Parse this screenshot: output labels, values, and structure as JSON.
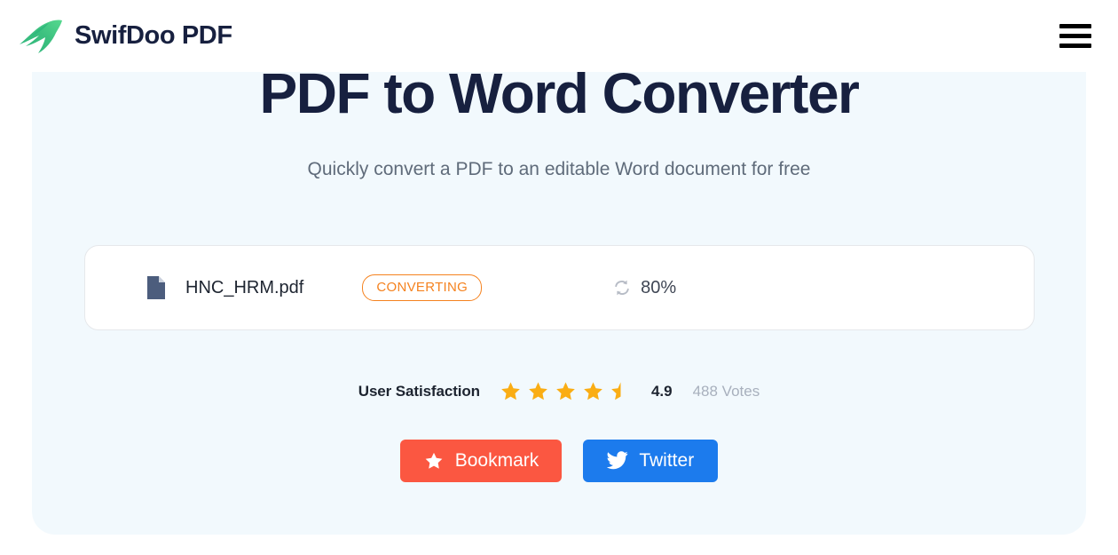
{
  "header": {
    "brand_name": "SwifDoo PDF",
    "logo_icon": "swift-bird-logo",
    "menu_icon": "hamburger-menu-icon"
  },
  "hero": {
    "title": "PDF to Word Converter",
    "subtitle": "Quickly convert a PDF to an editable Word document for free"
  },
  "file_card": {
    "file_icon": "pdf-document-icon",
    "file_name": "HNC_HRM.pdf",
    "status": "CONVERTING",
    "progress_icon": "sync-refresh-icon",
    "progress": "80%"
  },
  "rating": {
    "label": "User Satisfaction",
    "value": "4.9",
    "votes": "488 Votes",
    "stars_total": 5,
    "stars_filled": 4,
    "half_star": true
  },
  "actions": {
    "bookmark_label": "Bookmark",
    "bookmark_icon": "star-icon",
    "twitter_label": "Twitter",
    "twitter_icon": "twitter-bird-icon"
  },
  "colors": {
    "brand_dark": "#17203f",
    "panel_bg": "#f2f9fd",
    "status_orange": "#f5821f",
    "star_gold": "#faad14",
    "bookmark_red": "#fb5741",
    "twitter_blue": "#1c7bed",
    "file_icon_slate": "#4c5d7d"
  }
}
